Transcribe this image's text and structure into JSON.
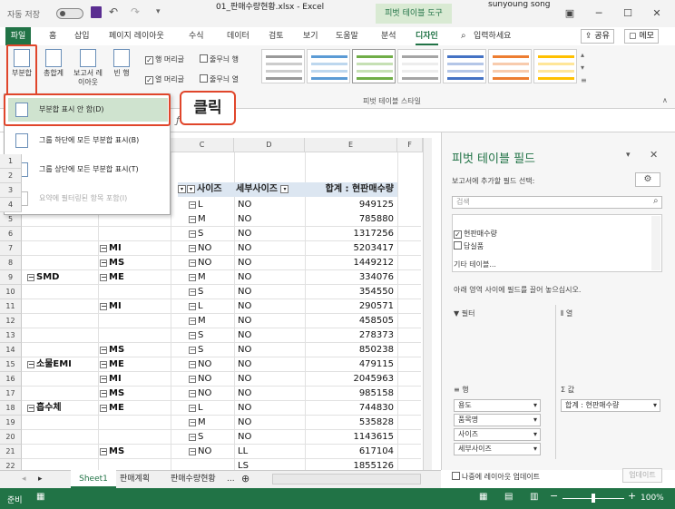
{
  "titlebar": {
    "autosave_label": "자동 저장",
    "autosave_state": "끔",
    "file_title": "01_판매수량현황.xlsx  -  Excel",
    "context_tab": "피벗 테이블 도구",
    "user": "sunyoung song"
  },
  "tabs": {
    "file": "파일",
    "items": [
      "홈",
      "삽입",
      "페이지 레이아웃",
      "수식",
      "데이터",
      "검토",
      "보기",
      "도움말",
      "분석"
    ],
    "design": "디자인",
    "search_label": "입력하세요",
    "share": "공유",
    "memo": "메모"
  },
  "ribbon": {
    "subtotal": "부분합",
    "grandtotal": "총합계",
    "report_layout": "보고서 레이아웃",
    "blank_rows": "빈 행",
    "row_headers": "행 머리글",
    "col_headers": "열 머리글",
    "banded_rows": "줄무늬 행",
    "banded_cols": "줄무늬 열",
    "styles_group": "피벗 테이블 스타일"
  },
  "menu": {
    "items": [
      "부분합 표시 안 함(D)",
      "그룹 하단에 모든 부분합 표시(B)",
      "그룹 상단에 모든 부분합 표시(T)",
      "요약에 필터링된 항목 포함(I)"
    ],
    "callout": "클릭"
  },
  "grid": {
    "columns": [
      "C",
      "D",
      "E",
      "F"
    ],
    "header": {
      "size": "사이즈",
      "subsize": "세부사이즈",
      "sum": "합계 : 현판매수량"
    },
    "rows": [
      {
        "n": "5",
        "a": "",
        "b": "",
        "c": "M",
        "d": "NO",
        "e": "785880"
      },
      {
        "n": "6",
        "a": "",
        "b": "",
        "c": "S",
        "d": "NO",
        "e": "1317256"
      },
      {
        "n": "7",
        "a": "",
        "b": "MI",
        "c": "NO",
        "d": "NO",
        "e": "5203417"
      },
      {
        "n": "8",
        "a": "",
        "b": "MS",
        "c": "NO",
        "d": "NO",
        "e": "1449212"
      },
      {
        "n": "9",
        "a": "SMD",
        "b": "ME",
        "c": "M",
        "d": "NO",
        "e": "334076"
      },
      {
        "n": "10",
        "a": "",
        "b": "",
        "c": "S",
        "d": "NO",
        "e": "354550"
      },
      {
        "n": "11",
        "a": "",
        "b": "MI",
        "c": "L",
        "d": "NO",
        "e": "290571"
      },
      {
        "n": "12",
        "a": "",
        "b": "",
        "c": "M",
        "d": "NO",
        "e": "458505"
      },
      {
        "n": "13",
        "a": "",
        "b": "",
        "c": "S",
        "d": "NO",
        "e": "278373"
      },
      {
        "n": "14",
        "a": "",
        "b": "MS",
        "c": "S",
        "d": "NO",
        "e": "850238"
      },
      {
        "n": "15",
        "a": "소물EMI",
        "b": "ME",
        "c": "NO",
        "d": "NO",
        "e": "479115"
      },
      {
        "n": "16",
        "a": "",
        "b": "MI",
        "c": "NO",
        "d": "NO",
        "e": "2045963"
      },
      {
        "n": "17",
        "a": "",
        "b": "MS",
        "c": "NO",
        "d": "NO",
        "e": "985158"
      },
      {
        "n": "18",
        "a": "흡수체",
        "b": "ME",
        "c": "L",
        "d": "NO",
        "e": "744830"
      },
      {
        "n": "19",
        "a": "",
        "b": "",
        "c": "M",
        "d": "NO",
        "e": "535828"
      },
      {
        "n": "20",
        "a": "",
        "b": "",
        "c": "S",
        "d": "NO",
        "e": "1143615"
      },
      {
        "n": "21",
        "a": "",
        "b": "MS",
        "c": "NO",
        "d": "LL",
        "e": "617104"
      },
      {
        "n": "22",
        "a": "",
        "b": "",
        "c": "",
        "d": "LS",
        "e": "1855126"
      }
    ],
    "row4": {
      "c": "L",
      "d": "NO",
      "e": "949125"
    }
  },
  "pane": {
    "title": "피벗 테이블 필드",
    "choose": "보고서에 추가할 필드 선택:",
    "search": "검색",
    "field1": "현판매수량",
    "field2": "답실품",
    "more": "기타 테이블...",
    "drag_hint": "아래 영역 사이에 필드를 끌어 놓으십시오.",
    "filter": "필터",
    "cols": "열",
    "rows": "행",
    "values": "값",
    "row_fields": [
      "용도",
      "품목명",
      "사이즈",
      "세부사이즈"
    ],
    "value_field": "합계 : 현판매수량",
    "defer": "나중에 레이아웃 업데이트",
    "update": "업데이트"
  },
  "sheets": {
    "tabs": [
      "Sheet1",
      "판매계획",
      "판매수량현황"
    ],
    "more": "..."
  },
  "status": {
    "ready": "준비",
    "zoom": "100%"
  }
}
